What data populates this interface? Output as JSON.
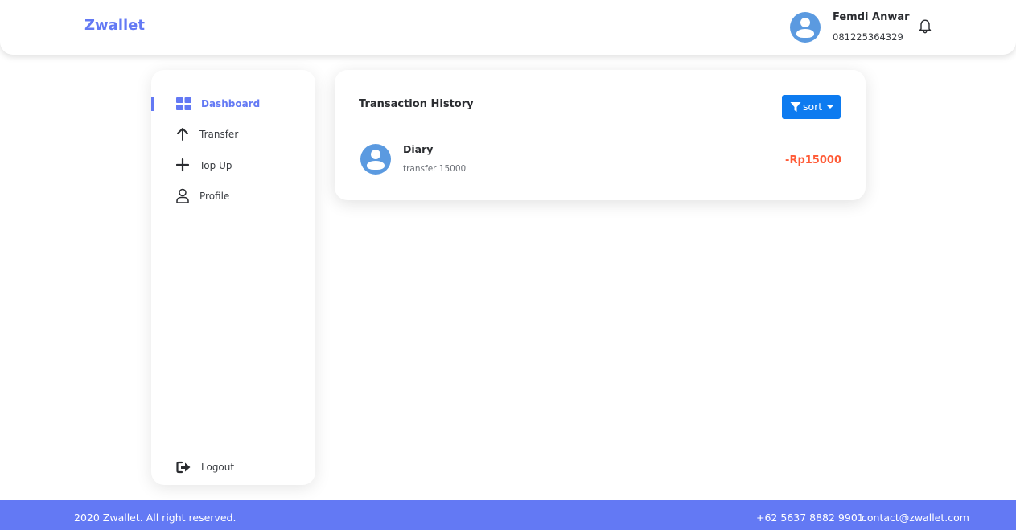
{
  "header": {
    "brand": "Zwallet",
    "user": {
      "name": "Femdi Anwar",
      "phone": "081225364329"
    }
  },
  "sidebar": {
    "items": [
      {
        "label": "Dashboard",
        "icon": "grid-icon",
        "active": true
      },
      {
        "label": "Transfer",
        "icon": "arrow-up-icon",
        "active": false
      },
      {
        "label": "Top Up",
        "icon": "plus-icon",
        "active": false
      },
      {
        "label": "Profile",
        "icon": "user-icon",
        "active": false
      }
    ],
    "logout": {
      "label": "Logout",
      "icon": "logout-icon"
    }
  },
  "main": {
    "title": "Transaction History",
    "sort_label": "sort",
    "transactions": [
      {
        "name": "Diary",
        "description": "transfer 15000",
        "amount": "-Rp15000"
      }
    ]
  },
  "footer": {
    "copyright": "2020 Zwallet. All right reserved.",
    "phone": "+62 5637 8882 9901",
    "email": "contact@zwallet.com"
  },
  "colors": {
    "brand": "#6379F4",
    "button": "#0d7bf0",
    "negative_amount": "#FF5B37",
    "avatar": "#5b9ae0"
  }
}
